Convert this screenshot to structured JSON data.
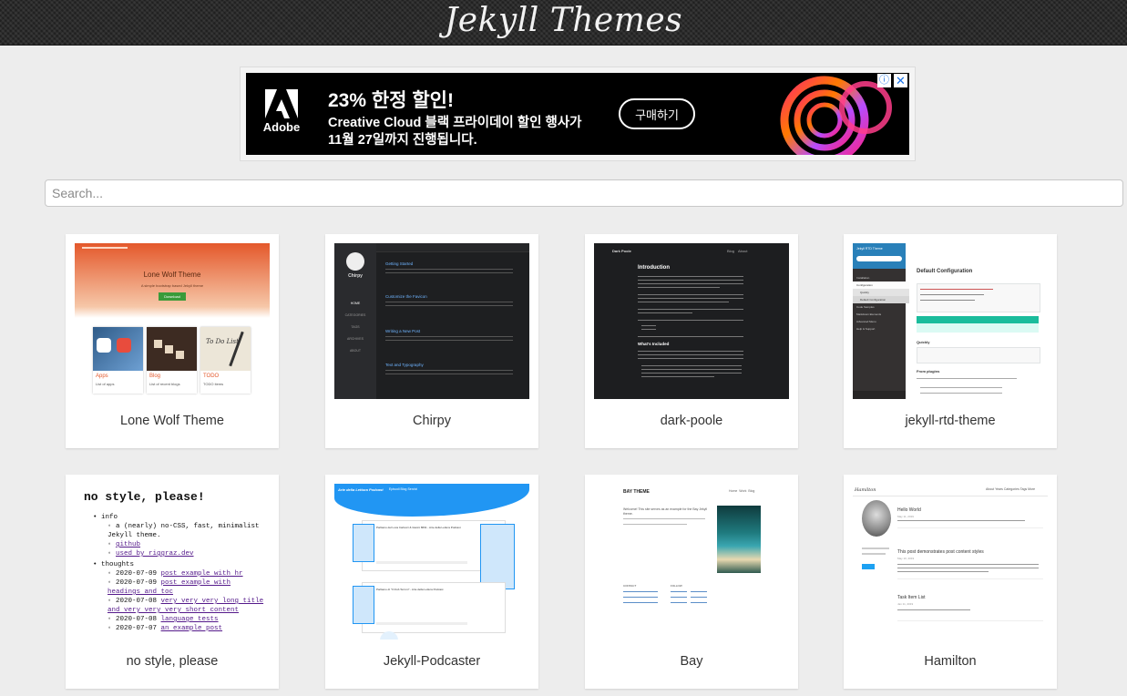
{
  "header": {
    "title": "Jekyll Themes"
  },
  "ad": {
    "brand": "Adobe",
    "headline": "23% 한정 할인!",
    "line1": "Creative Cloud 블랙 프라이데이 할인 행사가",
    "line2": "11월 27일까지 진행됩니다.",
    "cta": "구매하기",
    "info_icon": "info-icon",
    "close_icon": "close-icon"
  },
  "search": {
    "placeholder": "Search...",
    "value": ""
  },
  "themes": [
    {
      "name": "Lone Wolf Theme",
      "preview": {
        "title": "Lone Wolf Theme",
        "subtitle": "A simple bootstrap based Jekyll theme",
        "button": "Download",
        "tiles": [
          {
            "label": "Apps",
            "sub": "List of apps"
          },
          {
            "label": "Blog",
            "sub": "List of recent blogs"
          },
          {
            "label": "TODO",
            "sub": "TODO items"
          }
        ],
        "accent": "#e4582b"
      }
    },
    {
      "name": "Chirpy",
      "preview": {
        "site": "Chirpy",
        "nav": [
          "HOME",
          "CATEGORIES",
          "TAGS",
          "ARCHIVES",
          "ABOUT"
        ],
        "posts": [
          "Getting Started",
          "Customize the Favicon",
          "Writing a New Post",
          "Text and Typography"
        ],
        "accent": "#2a8fdc"
      }
    },
    {
      "name": "dark-poole",
      "preview": {
        "site": "Dark Poole",
        "nav": [
          "Blog",
          "About"
        ],
        "heading": "Introduction",
        "subheading": "What's Included"
      }
    },
    {
      "name": "jekyll-rtd-theme",
      "preview": {
        "site": "Jekyll RTD Theme",
        "heading": "Default Configuration",
        "sections": [
          "Quickly",
          "Default Configuration",
          "From plugins"
        ],
        "menu": [
          "Installation",
          "Configuration",
          "Quickly",
          "Default Configuration",
          "Code Samples",
          "Markdown Elements",
          "Advanced Menu",
          "Help & Support"
        ],
        "accent": "#2980b9"
      }
    },
    {
      "name": "no style, please",
      "preview": {
        "heading": "no style, please!",
        "items": [
          {
            "text": "info",
            "children": [
              {
                "text": "a (nearly) no-CSS, fast, minimalist Jekyll theme."
              },
              {
                "text": "github",
                "link": true
              },
              {
                "text": "used by riggraz.dev",
                "link": true
              }
            ]
          },
          {
            "text": "thoughts",
            "children": [
              {
                "date": "2020-07-09",
                "text": "post example with hr",
                "link": true
              },
              {
                "date": "2020-07-09",
                "text": "post example with headings and toc",
                "link": true
              },
              {
                "date": "2020-07-08",
                "text": "very very very long title and very very very short content",
                "link": true
              },
              {
                "date": "2020-07-08",
                "text": "language tests",
                "link": true
              },
              {
                "date": "2020-07-07",
                "text": "an example post",
                "link": true
              }
            ]
          }
        ]
      }
    },
    {
      "name": "Jekyll-Podcaster",
      "preview": {
        "site": "Arte della Lettura Podcast",
        "nav": [
          "Episodi",
          "Blog",
          "Servizi",
          "Blog"
        ],
        "episodes": [
          "Parliamo del Luca Carlucci & Gianni 8691 - Arte della Lettura Podcast",
          "Parliamo di \"Il Club Terroni\" - Arte della Lettura Podcast"
        ],
        "accent": "#2196f3"
      }
    },
    {
      "name": "Bay",
      "preview": {
        "site": "BAY THEME",
        "nav": [
          "Home",
          "Work",
          "Blog"
        ],
        "intro": "Welcome! This site serves as an example for the Bay Jekyll theme.",
        "columns": [
          "CONTACT",
          "FOLLOW"
        ]
      }
    },
    {
      "name": "Hamilton",
      "preview": {
        "site": "Hamilton",
        "nav": [
          "About",
          "Years",
          "Categories",
          "Tags",
          "More"
        ],
        "posts": [
          {
            "title": "Hello World",
            "date": "May 11, 2019"
          },
          {
            "title": "This post demonstrates post content styles",
            "date": "May 10, 2019"
          },
          {
            "title": "Task Item List",
            "date": "Jan 11, 2019"
          }
        ]
      }
    }
  ]
}
